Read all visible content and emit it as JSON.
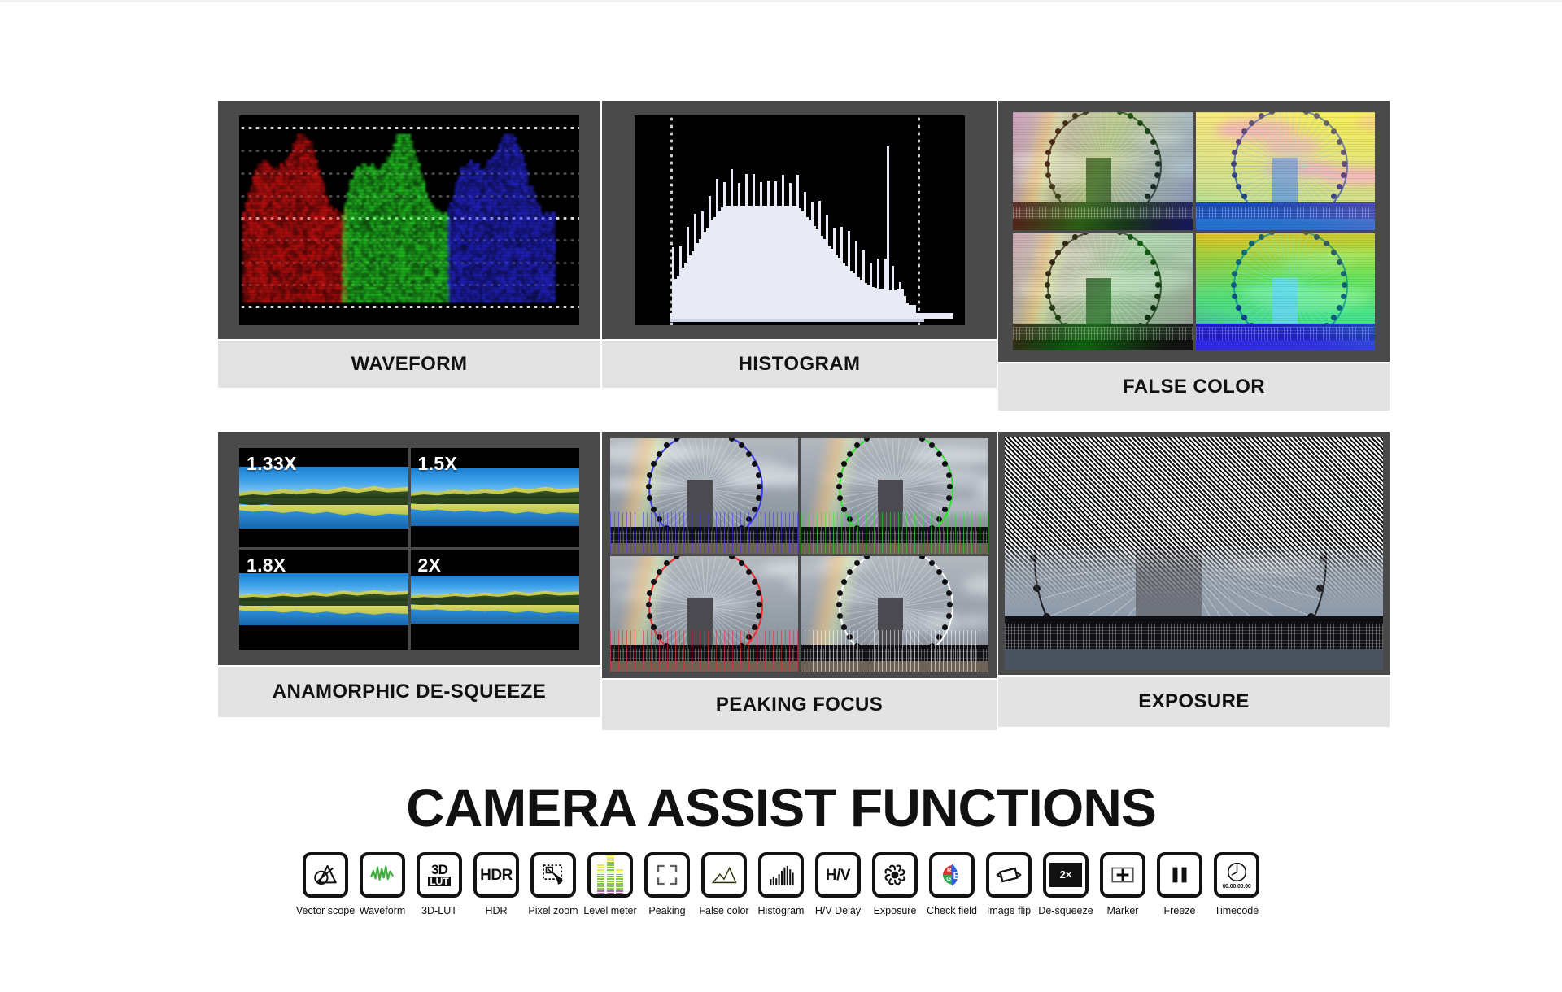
{
  "features": {
    "row1": [
      {
        "id": "waveform",
        "caption": "WAVEFORM"
      },
      {
        "id": "histogram",
        "caption": "HISTOGRAM"
      },
      {
        "id": "false-color",
        "caption": "FALSE COLOR"
      }
    ],
    "row2": [
      {
        "id": "anamorphic-de-squeeze",
        "caption": "ANAMORPHIC DE-SQUEEZE"
      },
      {
        "id": "peaking-focus",
        "caption": "PEAKING FOCUS"
      },
      {
        "id": "exposure",
        "caption": "EXPOSURE"
      }
    ]
  },
  "anamorphic": {
    "ratios": [
      "1.33X",
      "1.5X",
      "1.8X",
      "2X"
    ]
  },
  "title": "CAMERA ASSIST FUNCTIONS",
  "icons": [
    {
      "name": "vector-scope-icon",
      "label": "Vector scope",
      "glyph": ""
    },
    {
      "name": "waveform-icon",
      "label": "Waveform",
      "glyph": ""
    },
    {
      "name": "3d-lut-icon",
      "label": "3D-LUT",
      "glyph": "3D",
      "glyph2": "LUT"
    },
    {
      "name": "hdr-icon",
      "label": "HDR",
      "glyph": "HDR"
    },
    {
      "name": "pixel-zoom-icon",
      "label": "Pixel zoom",
      "glyph": ""
    },
    {
      "name": "level-meter-icon",
      "label": "Level meter",
      "glyph": ""
    },
    {
      "name": "peaking-icon",
      "label": "Peaking",
      "glyph": ""
    },
    {
      "name": "false-color-icon",
      "label": "False color",
      "glyph": ""
    },
    {
      "name": "histogram-icon",
      "label": "Histogram",
      "glyph": ""
    },
    {
      "name": "hv-delay-icon",
      "label": "H/V Delay",
      "glyph": "H/V"
    },
    {
      "name": "exposure-icon",
      "label": "Exposure",
      "glyph": ""
    },
    {
      "name": "check-field-icon",
      "label": "Check field",
      "glyph": "",
      "sub": [
        "R",
        "G",
        "B"
      ]
    },
    {
      "name": "image-flip-icon",
      "label": "Image flip",
      "glyph": ""
    },
    {
      "name": "de-squeeze-icon",
      "label": "De-squeeze",
      "glyph": "2×"
    },
    {
      "name": "marker-icon",
      "label": "Marker",
      "glyph": "+"
    },
    {
      "name": "freeze-icon",
      "label": "Freeze",
      "glyph": ""
    },
    {
      "name": "timecode-icon",
      "label": "Timecode",
      "glyph": "00:00:00:00"
    }
  ],
  "colors": {
    "page_bg": "#ffffff",
    "panel_bg": "#4a4a4a",
    "caption_bg": "#e3e3e3",
    "text": "#111111",
    "icon_stroke": "#121212",
    "waveform_red": "#e11111",
    "waveform_green": "#22dd22",
    "waveform_blue": "#2222ee",
    "waveform_icon_green": "#3fae3f",
    "check_field_red": "#e03030",
    "check_field_green": "#2fa84f",
    "check_field_blue": "#2f5fd0"
  }
}
